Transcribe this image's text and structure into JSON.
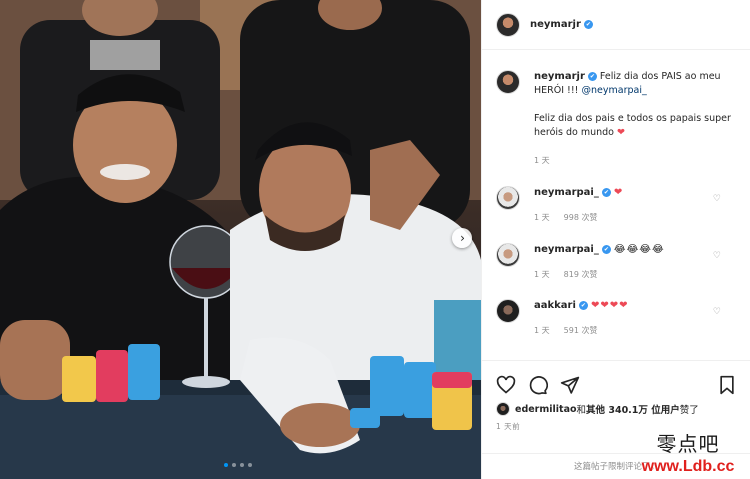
{
  "post": {
    "photo_alt": "Photo of two men at a poker table with chips",
    "carousel": {
      "dots": 4,
      "active": 0
    }
  },
  "header": {
    "username": "neymarjr",
    "verified_mark": "✔"
  },
  "caption": {
    "username": "neymarjr",
    "text_before_mention": "Feliz dia dos PAIS ao meu HERÓI !!! ",
    "mention": "@neymarpai_",
    "line2": "Feliz dia dos pais e todos os papais super heróis do mundo ",
    "heart": "❤",
    "time": "1 天"
  },
  "comments": [
    {
      "username": "neymarpai_",
      "text": "❤",
      "time": "1 天",
      "likes": "998 次赞",
      "avatar_icon": "avatar-neymarpai"
    },
    {
      "username": "neymarpai_",
      "text": "😂😂😂😂",
      "time": "1 天",
      "likes": "819 次赞",
      "avatar_icon": "avatar-neymarpai"
    },
    {
      "username": "aakkari",
      "text": "❤❤❤❤",
      "time": "1 天",
      "likes": "591 次赞",
      "avatar_icon": "avatar-aakkari"
    }
  ],
  "actions": {
    "like_icon": "heart-outline-icon",
    "comment_icon": "comment-icon",
    "share_icon": "paper-plane-icon",
    "save_icon": "bookmark-icon"
  },
  "liked_by": {
    "user": "edermilitao",
    "connector": " 和 ",
    "others": "其他 340.1万 位用户",
    "suffix": " 赞了"
  },
  "post_time": "1 天前",
  "comments_limited": "这篇帖子限制评论了。",
  "watermark": {
    "chinese": "零点吧",
    "url": "www.Ldb.cc"
  },
  "colors": {
    "verified": "#3897f0",
    "heart": "#ed4956",
    "muted": "#8e8e8e",
    "watermark_url": "#e0201d"
  }
}
